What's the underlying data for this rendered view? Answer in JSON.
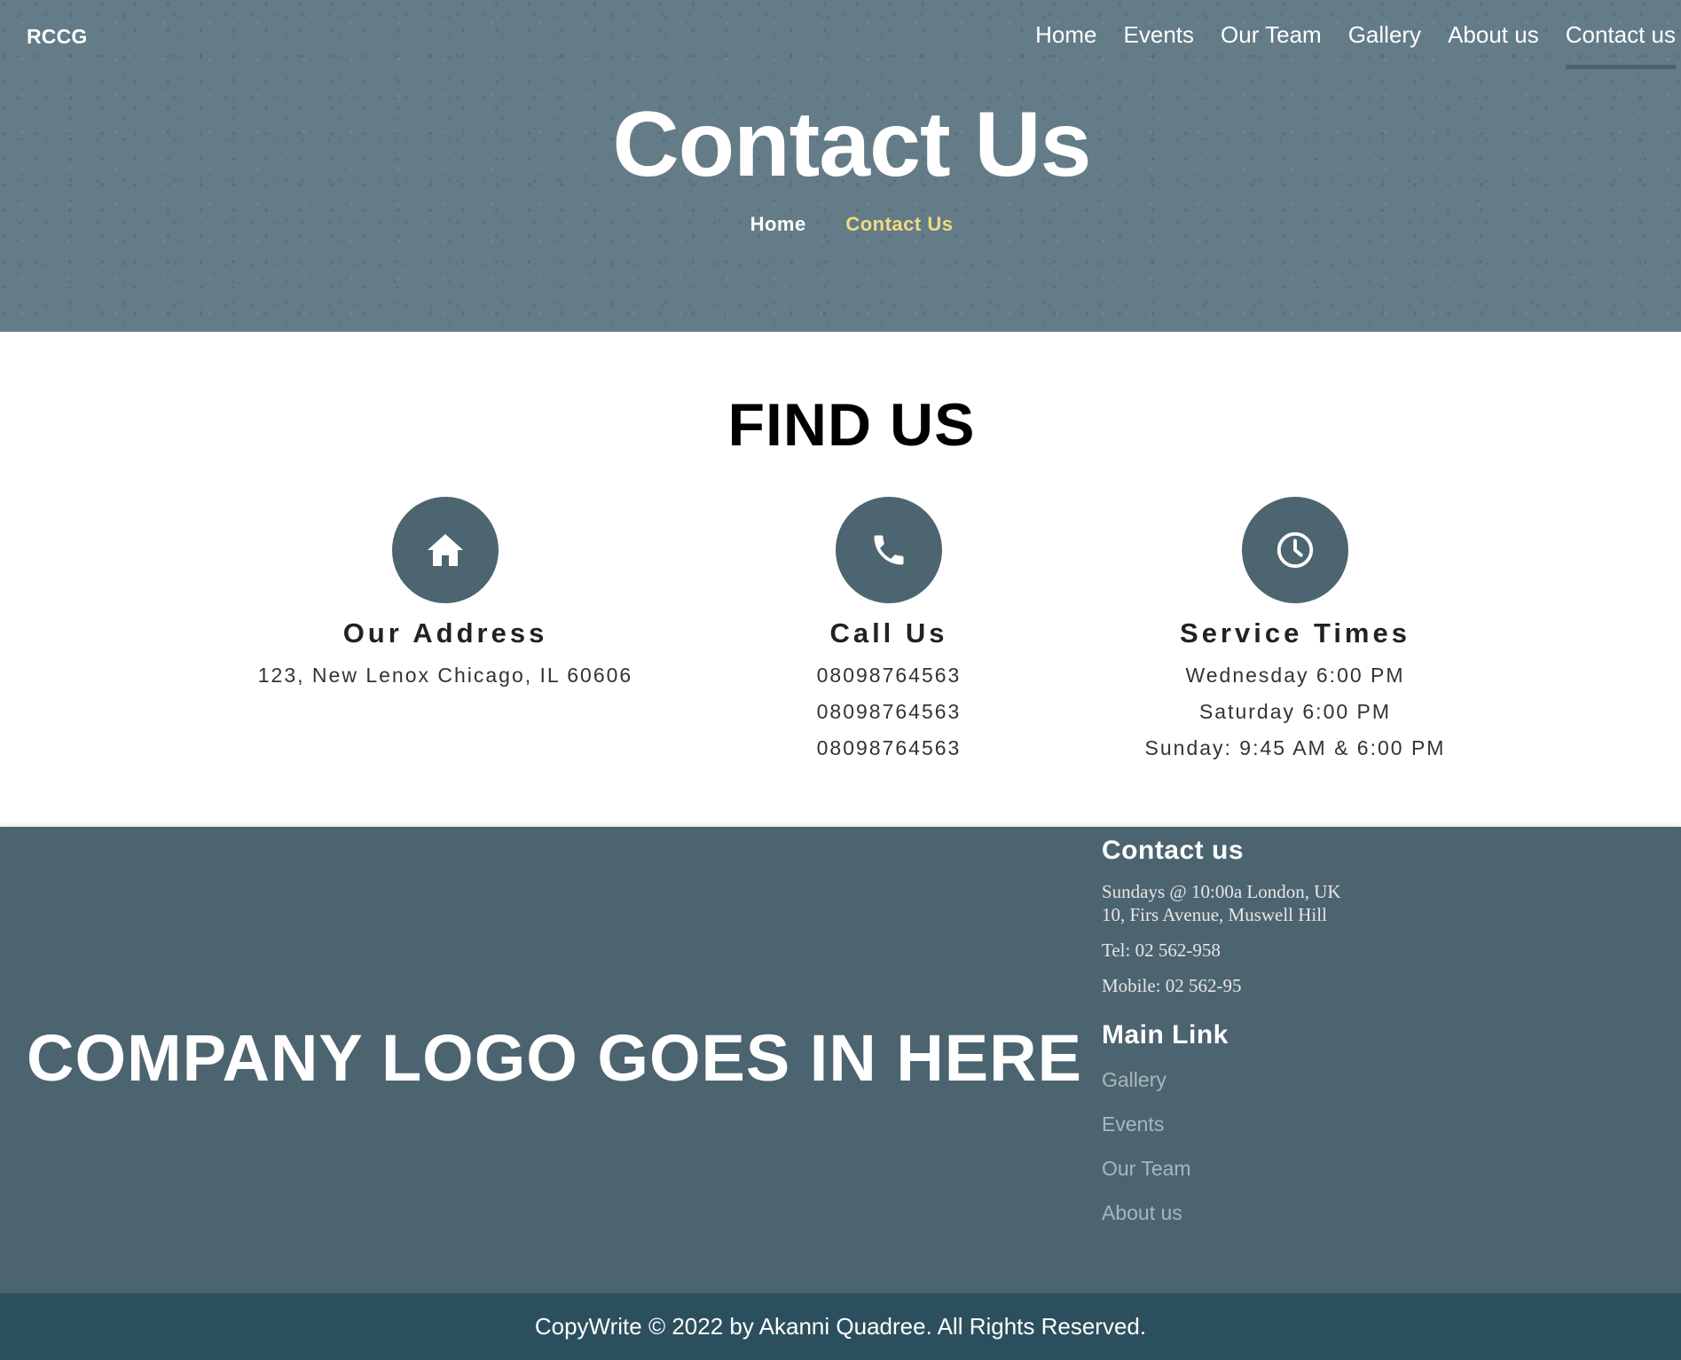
{
  "header": {
    "brand": "RCCG",
    "nav": [
      {
        "label": "Home"
      },
      {
        "label": "Events"
      },
      {
        "label": "Our Team"
      },
      {
        "label": "Gallery"
      },
      {
        "label": "About us"
      },
      {
        "label": "Contact us",
        "active": true
      }
    ]
  },
  "hero": {
    "title": "Contact Us",
    "breadcrumb": {
      "home": "Home",
      "current": "Contact Us"
    },
    "colors": {
      "background": "#637c87",
      "breadcrumb_active": "#f2da82"
    }
  },
  "find_us": {
    "title": "FIND US",
    "columns": [
      {
        "icon": "home-icon",
        "heading": "Our Address",
        "lines": [
          "123, New Lenox Chicago, IL 60606"
        ]
      },
      {
        "icon": "phone-icon",
        "heading": "Call Us",
        "lines": [
          "08098764563",
          "08098764563",
          "08098764563"
        ]
      },
      {
        "icon": "clock-icon",
        "heading": "Service Times",
        "lines": [
          "Wednesday 6:00 PM",
          "Saturday 6:00 PM",
          "Sunday: 9:45 AM & 6:00 PM"
        ]
      }
    ],
    "colors": {
      "icon_circle": "#4d6570"
    }
  },
  "footer": {
    "logo_placeholder": "COMPANY LOGO GOES IN HERE",
    "contact": {
      "heading": "Contact us",
      "address": "Sundays @ 10:00a London, UK 10, Firs Avenue, Muswell Hill",
      "tel": "Tel: 02 562-958",
      "mobile": "Mobile: 02 562-95"
    },
    "links": {
      "heading": "Main Link",
      "items": [
        "Gallery",
        "Events",
        "Our Team",
        "About us"
      ]
    },
    "copyright": "CopyWrite © 2022 by Akanni Quadree. All Rights Reserved.",
    "colors": {
      "background": "#4c6470",
      "copyright_bar": "#2c4f5e"
    }
  }
}
